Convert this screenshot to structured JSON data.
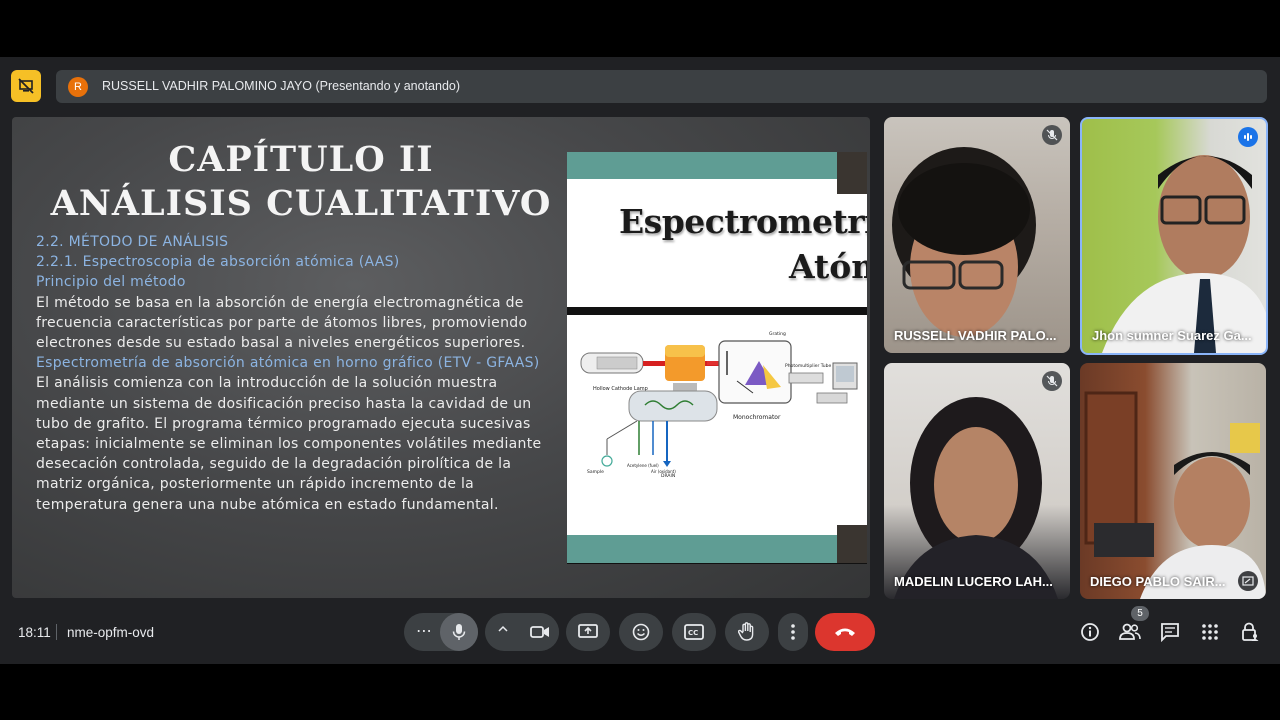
{
  "presenter": {
    "avatar_initial": "R",
    "label": "RUSSELL VADHIR PALOMINO JAYO (Presentando y anotando)"
  },
  "slide": {
    "title_line1": "CAPÍTULO II",
    "title_line2": "ANÁLISIS CUALITATIVO",
    "heading1": "2.2. MÉTODO DE ANÁLISIS",
    "heading2": "2.2.1. Espectroscopia de absorción atómica (AAS)",
    "heading3": "Principio del método",
    "para1": [
      "El método se basa en la absorción de energía electromagnética de",
      "frecuencia características por parte de átomos libres, promoviendo",
      "electrones desde su estado basal a niveles energéticos superiores."
    ],
    "heading4": "Espectrometría de absorción atómica en horno gráfico (ETV - GFAAS)",
    "para2": [
      "El análisis comienza con la introducción de la solución muestra",
      "mediante un sistema de dosificación preciso hasta la cavidad de un",
      "tubo de grafito. El programa térmico programado ejecuta sucesivas",
      "etapas: inicialmente se eliminan los componentes volátiles mediante",
      "desecación controlada, seguido de la degradación pirolítica de la",
      "matriz orgánica, posteriormente un rápido incremento de la",
      "temperatura genera una nube atómica en estado fundamental."
    ],
    "image_title_line1": "Espectrometría",
    "image_title_line2": "Atóm",
    "diagram_labels": {
      "lamp": "Hollow Cathode Lamp",
      "monochromator": "Monochromator",
      "grating": "Grating",
      "detector": "Photomultiplier Tube",
      "sample": "Sample",
      "acetylene": "Acetylene (fuel)",
      "air": "Air (oxidant)",
      "drain": "DRAIN"
    }
  },
  "participants": [
    {
      "name": "RUSSELL VADHIR PALO...",
      "mic": "muted"
    },
    {
      "name": "Jhon sumner Suarez Ga...",
      "mic": "speaking"
    },
    {
      "name": "MADELIN LUCERO LAH...",
      "mic": "muted"
    },
    {
      "name": "DIEGO PABLO SAIR...",
      "mic": "none"
    }
  ],
  "bottom_bar": {
    "time": "18:11",
    "meeting_code": "nme-opfm-ovd",
    "people_count": "5"
  },
  "colors": {
    "accent_yellow": "#f6c026",
    "end_call_red": "#dc362e",
    "slide_blue_text": "#8cb4e2",
    "teal": "#5f9d94"
  }
}
